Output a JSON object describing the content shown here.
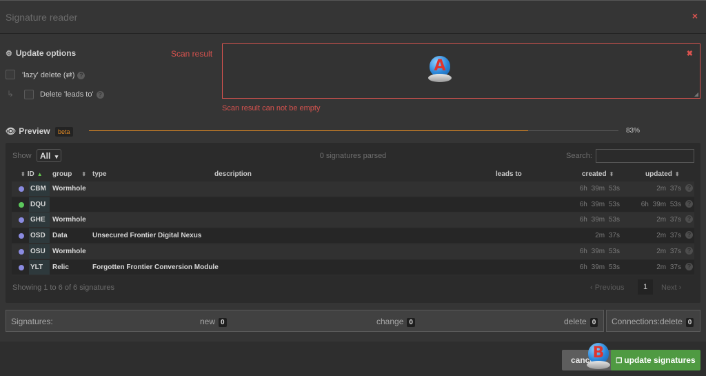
{
  "window": {
    "title": "Signature reader",
    "close_icon": "×"
  },
  "options": {
    "title": "Update options",
    "lazy_delete_label": "'lazy' delete",
    "lazy_delete_glyph": "(⇄)",
    "delete_leads_label": "Delete 'leads to'"
  },
  "scan": {
    "label": "Scan result",
    "value": "",
    "error": "Scan result can not be empty"
  },
  "preview": {
    "title": "Preview",
    "badge": "beta",
    "progress_text": "83%",
    "progress": 0.83
  },
  "table_controls": {
    "show_label": "Show",
    "show_value": "All",
    "parsed_text": "0 signatures parsed",
    "search_label": "Search:"
  },
  "columns": [
    "ID",
    "group",
    "type",
    "description",
    "leads to",
    "created",
    "updated"
  ],
  "rows": [
    {
      "id": "CBM",
      "group": "Wormhole",
      "type": "",
      "created": "6h 39m 53s",
      "updated": "2m 37s",
      "dot_color": "#8a8be0"
    },
    {
      "id": "DQU",
      "group": "",
      "type": "",
      "created": "6h 39m 53s",
      "updated": "6h 39m 53s",
      "dot_color": "#5cc85c"
    },
    {
      "id": "GHE",
      "group": "Wormhole",
      "type": "",
      "created": "6h 39m 53s",
      "updated": "2m 37s",
      "dot_color": "#8a8be0"
    },
    {
      "id": "OSD",
      "group": "Data",
      "type": "Unsecured Frontier Digital Nexus",
      "created": "2m 37s",
      "updated": "2m 37s",
      "dot_color": "#8a8be0"
    },
    {
      "id": "OSU",
      "group": "Wormhole",
      "type": "",
      "created": "6h 39m 53s",
      "updated": "2m 37s",
      "dot_color": "#8a8be0"
    },
    {
      "id": "YLT",
      "group": "Relic",
      "type": "Forgotten Frontier Conversion Module",
      "created": "6h 39m 53s",
      "updated": "2m 37s",
      "dot_color": "#8a8be0"
    }
  ],
  "pagination": {
    "info": "Showing 1 to 6 of 6 signatures",
    "prev": "‹ Previous",
    "page": "1",
    "next": "Next ›"
  },
  "summary": {
    "signatures_label": "Signatures:",
    "new_label": "new",
    "new_count": "0",
    "change_label": "change",
    "change_count": "0",
    "delete_label": "delete",
    "delete_count": "0",
    "connections_label": "Connections:delete",
    "connections_count": "0"
  },
  "footer": {
    "cancel_label": "cancel",
    "update_label": "update signatures"
  },
  "markers": {
    "a": "A",
    "b": "B"
  }
}
